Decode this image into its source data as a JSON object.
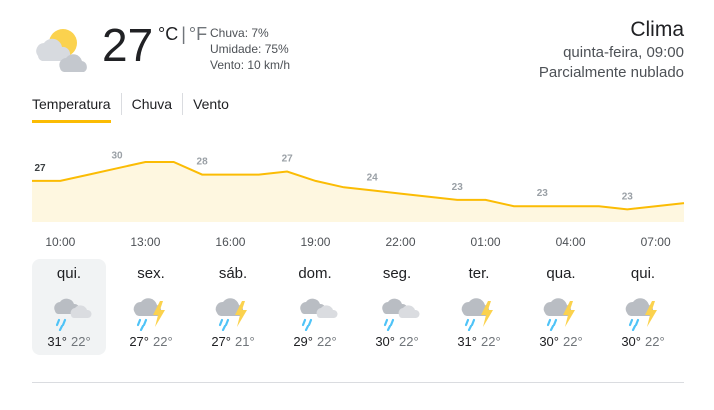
{
  "current": {
    "temperature": "27",
    "unit_c": "°C",
    "unit_sep": "|",
    "unit_f": "°F",
    "icon": "partly-cloudy-icon",
    "rain": "Chuva: 7%",
    "humidity": "Umidade: 75%",
    "wind": "Vento: 10 km/h"
  },
  "header": {
    "title": "Clima",
    "datetime": "quinta-feira, 09:00",
    "condition": "Parcialmente nublado"
  },
  "tabs": [
    {
      "label": "Temperatura",
      "active": true
    },
    {
      "label": "Chuva",
      "active": false
    },
    {
      "label": "Vento",
      "active": false
    }
  ],
  "chart_data": {
    "type": "area",
    "x": [
      "09:00",
      "10:00",
      "11:00",
      "12:00",
      "13:00",
      "14:00",
      "15:00",
      "16:00",
      "17:00",
      "18:00",
      "19:00",
      "20:00",
      "21:00",
      "22:00",
      "23:00",
      "00:00",
      "01:00",
      "02:00",
      "03:00",
      "04:00",
      "05:00",
      "06:00",
      "07:00",
      "08:00"
    ],
    "values": [
      27,
      27,
      28,
      29,
      30,
      30,
      28,
      28,
      28,
      28.5,
      27,
      26,
      25.5,
      25,
      24.5,
      24,
      24,
      23,
      23,
      23,
      23,
      22.5,
      23,
      23.5
    ],
    "labeled_points": [
      {
        "index": 0,
        "value": "27"
      },
      {
        "index": 3,
        "value": "30"
      },
      {
        "index": 6,
        "value": "28"
      },
      {
        "index": 9,
        "value": "27"
      },
      {
        "index": 12,
        "value": "24"
      },
      {
        "index": 15,
        "value": "23"
      },
      {
        "index": 18,
        "value": "23"
      },
      {
        "index": 21,
        "value": "23"
      }
    ],
    "time_labels": [
      "10:00",
      "13:00",
      "16:00",
      "19:00",
      "22:00",
      "01:00",
      "04:00",
      "07:00"
    ],
    "line_color": "#fbbc04",
    "fill_color": "#fef7e0"
  },
  "days": [
    {
      "name": "qui.",
      "icon": "cloudy-rain-icon",
      "high": "31°",
      "low": "22°",
      "selected": true
    },
    {
      "name": "sex.",
      "icon": "thunderstorm-icon",
      "high": "27°",
      "low": "22°",
      "selected": false
    },
    {
      "name": "sáb.",
      "icon": "thunderstorm-icon",
      "high": "27°",
      "low": "21°",
      "selected": false
    },
    {
      "name": "dom.",
      "icon": "cloudy-rain-icon",
      "high": "29°",
      "low": "22°",
      "selected": false
    },
    {
      "name": "seg.",
      "icon": "cloudy-rain-icon",
      "high": "30°",
      "low": "22°",
      "selected": false
    },
    {
      "name": "ter.",
      "icon": "thunderstorm-icon",
      "high": "31°",
      "low": "22°",
      "selected": false
    },
    {
      "name": "qua.",
      "icon": "thunderstorm-icon",
      "high": "30°",
      "low": "22°",
      "selected": false
    },
    {
      "name": "qui.",
      "icon": "thunderstorm-icon",
      "high": "30°",
      "low": "22°",
      "selected": false
    }
  ]
}
